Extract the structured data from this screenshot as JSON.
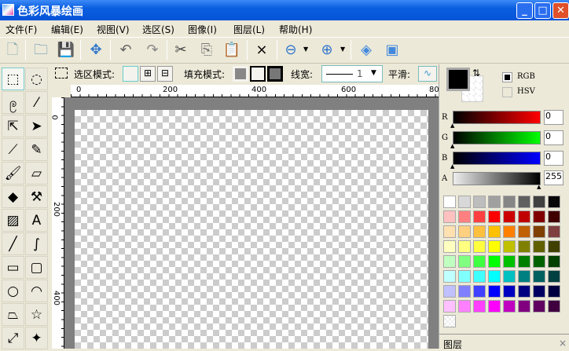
{
  "window": {
    "title": "色彩风暴绘画",
    "minimize": "_",
    "maximize": "□",
    "close": "✕"
  },
  "menu": [
    "文件(F)",
    "编辑(E)",
    "视图(V)",
    "选区(S)",
    "图像(I)",
    "图层(L)",
    "帮助(H)"
  ],
  "toolbar": [
    "new-file",
    "open-folder",
    "save",
    "move",
    "undo",
    "redo",
    "cut",
    "copy",
    "paste",
    "deselect",
    "zoom-out",
    "zoom-in",
    "fit-window",
    "actual-size"
  ],
  "options": {
    "selection_mode_label": "选区模式:",
    "fill_mode_label": "填充模式:",
    "line_width_label": "线宽:",
    "line_width_value": "1",
    "smooth_label": "平滑:"
  },
  "tools": [
    "rect-select",
    "ellipse-select",
    "lasso",
    "magic-wand",
    "node-select",
    "move-selection",
    "color-picker",
    "pencil",
    "brush",
    "eraser",
    "paint-bucket",
    "clone-stamp",
    "image",
    "text",
    "line",
    "curve",
    "rectangle",
    "rounded-rectangle",
    "ellipse",
    "arc",
    "polygon",
    "star",
    "arrow-line",
    "gradient"
  ],
  "ruler": {
    "top": [
      "0",
      "200",
      "400",
      "600",
      "80"
    ],
    "left": [
      "0",
      "200",
      "400"
    ]
  },
  "color_panel": {
    "rgb_label": "RGB",
    "hsv_label": "HSV",
    "r_label": "R",
    "g_label": "G",
    "b_label": "B",
    "a_label": "A",
    "r": "0",
    "g": "0",
    "b": "0",
    "a": "255",
    "primary": "#000000"
  },
  "palette": [
    [
      "#ffffff",
      "#d8d8d8",
      "#bdbdbd",
      "#a0a0a0",
      "#868686",
      "#606060",
      "#404040",
      "#080808"
    ],
    [
      "#ffc0c0",
      "#ff8080",
      "#ff4040",
      "#ff0000",
      "#cc0000",
      "#c00000",
      "#800000",
      "#400000"
    ],
    [
      "#ffe0b0",
      "#ffd080",
      "#ffc040",
      "#ffc000",
      "#ff8000",
      "#c06000",
      "#804000",
      "#804040"
    ],
    [
      "#ffffc0",
      "#ffff80",
      "#ffff40",
      "#ffff00",
      "#c0c000",
      "#808000",
      "#606000",
      "#404000"
    ],
    [
      "#c0ffc0",
      "#80ff80",
      "#40ff40",
      "#00ff00",
      "#00c000",
      "#008000",
      "#006000",
      "#004000"
    ],
    [
      "#c0ffff",
      "#80ffff",
      "#40ffff",
      "#00ffff",
      "#00c0c0",
      "#008080",
      "#006060",
      "#004040"
    ],
    [
      "#c0c0ff",
      "#8080ff",
      "#4040ff",
      "#0000ff",
      "#0000c0",
      "#000080",
      "#000060",
      "#000040"
    ],
    [
      "#ffc0ff",
      "#ff80ff",
      "#ff40ff",
      "#ff00ff",
      "#c000c0",
      "#800080",
      "#600060",
      "#400040"
    ]
  ],
  "layers_panel": {
    "title": "图层",
    "close": "×"
  }
}
